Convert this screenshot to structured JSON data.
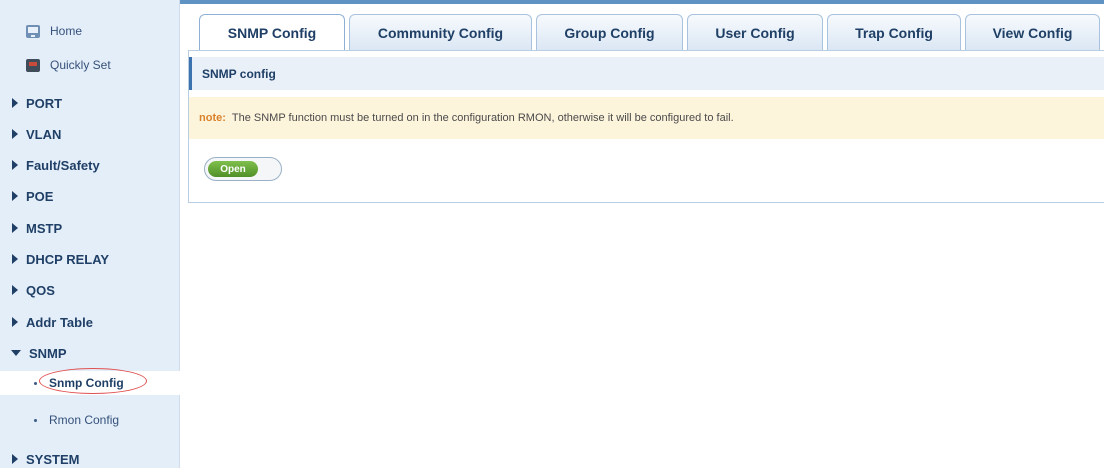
{
  "sidebar": {
    "home": "Home",
    "quickly_set": "Quickly Set",
    "items": [
      "PORT",
      "VLAN",
      "Fault/Safety",
      "POE",
      "MSTP",
      "DHCP RELAY",
      "QOS",
      "Addr Table",
      "SNMP"
    ],
    "snmp_sub": [
      "Snmp Config",
      "Rmon Config"
    ],
    "system": "SYSTEM"
  },
  "tabs": [
    "SNMP Config",
    "Community Config",
    "Group Config",
    "User Config",
    "Trap Config",
    "View Config"
  ],
  "main": {
    "section_title": "SNMP config",
    "note_label": "note:",
    "note_text": "The SNMP function must be turned on in the configuration RMON, otherwise it will be configured to fail.",
    "toggle_label": "Open"
  }
}
